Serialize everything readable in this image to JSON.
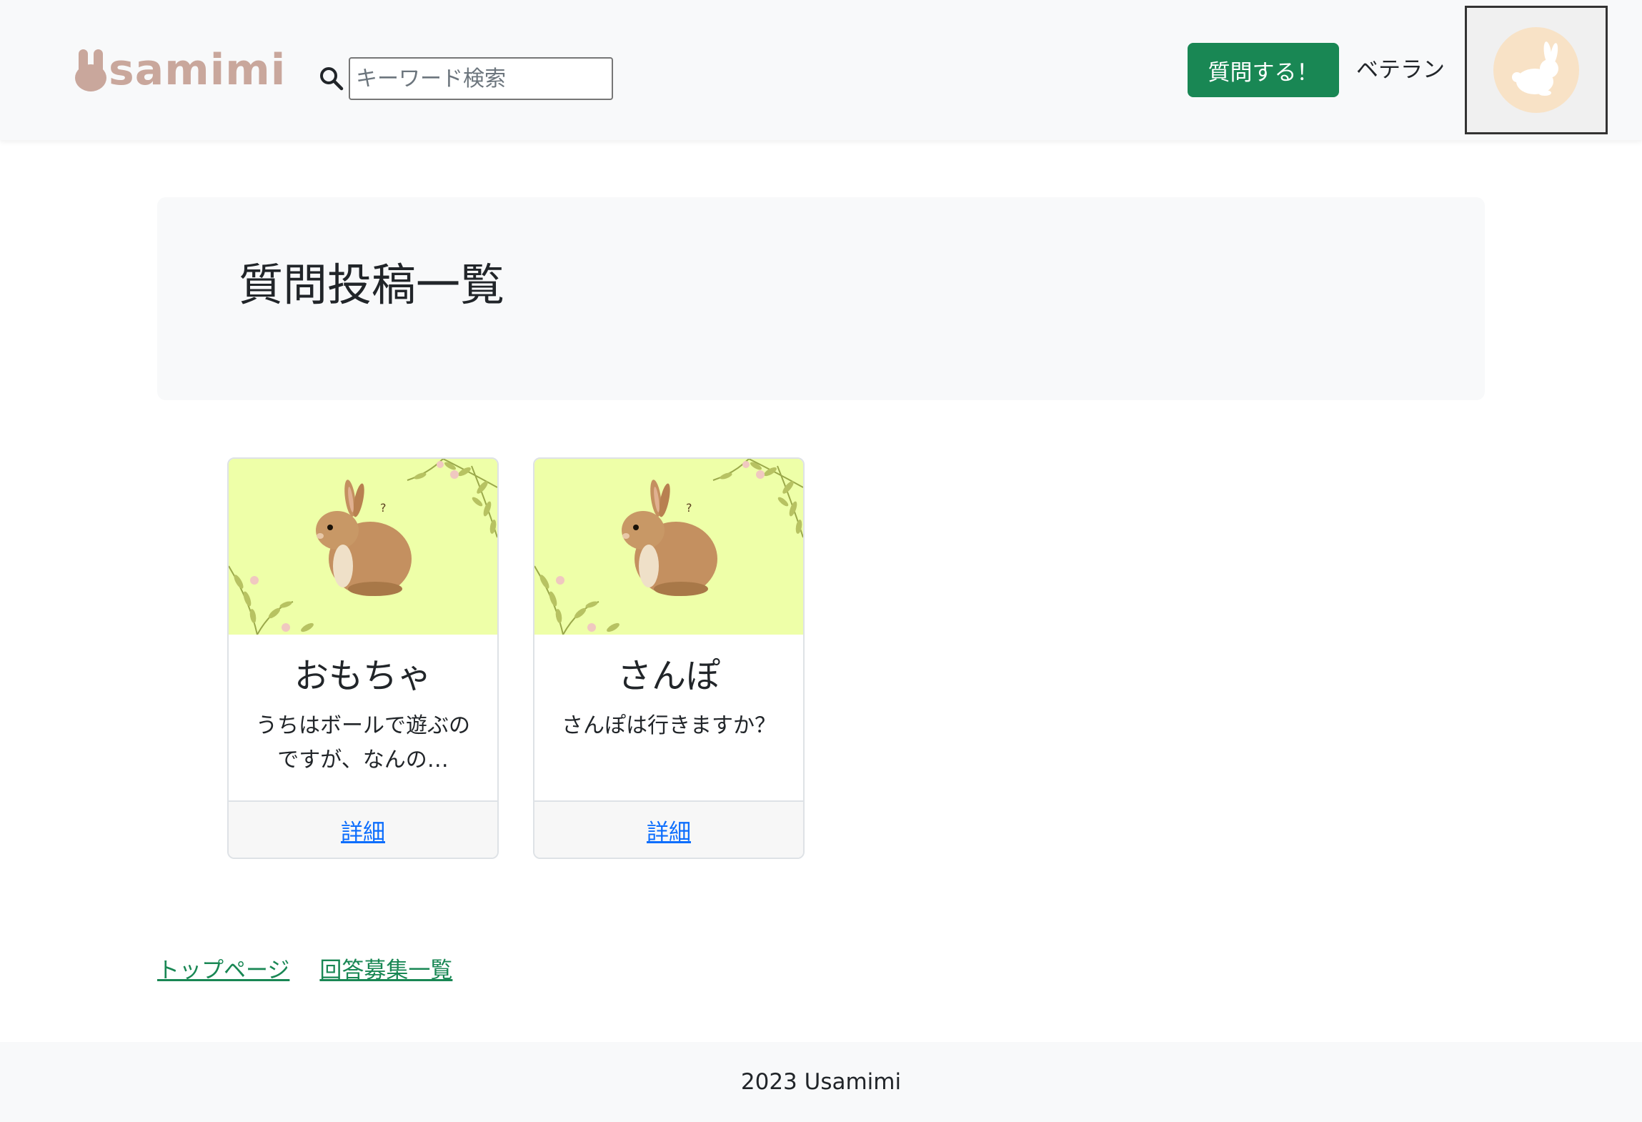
{
  "header": {
    "logo_text": "samimi",
    "search_placeholder": "キーワード検索",
    "ask_button_label": "質問する！",
    "user_rank": "ベテラン",
    "brand_color": "#c9a79c",
    "accent_color": "#198754"
  },
  "main": {
    "page_title": "質問投稿一覧",
    "cards": [
      {
        "title": "おもちゃ",
        "text": "うちはボールで遊ぶのですが、なんの…",
        "link_label": "詳細"
      },
      {
        "title": "さんぽ",
        "text": "さんぽは行きますか？",
        "link_label": "詳細"
      }
    ]
  },
  "links": {
    "top_page": "トップページ",
    "answer_list": "回答募集一覧"
  },
  "footer": {
    "copyright": "2023 Usamimi"
  },
  "icons": [
    "rabbit-logo-icon",
    "search-icon",
    "rabbit-avatar-icon",
    "rabbit-photo"
  ]
}
